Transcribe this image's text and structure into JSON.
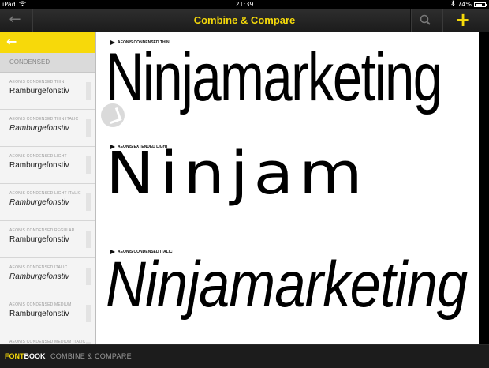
{
  "status": {
    "device": "iPad",
    "time": "21:39",
    "battery": "74%",
    "battery_level": 0.74
  },
  "nav": {
    "title": "Combine & Compare",
    "back_icon": "arrow-left-icon",
    "search_icon": "search-icon",
    "add_icon": "plus-icon"
  },
  "sidebar": {
    "section": "CONDENSED",
    "items": [
      {
        "name": "AEONIS CONDENSED THIN",
        "sample": "Ramburgefonstiv",
        "italic": false
      },
      {
        "name": "AEONIS CONDENSED THIN ITALIC",
        "sample": "Ramburgefonstiv",
        "italic": true
      },
      {
        "name": "AEONIS CONDENSED LIGHT",
        "sample": "Ramburgefonstiv",
        "italic": false
      },
      {
        "name": "AEONIS CONDENSED LIGHT ITALIC",
        "sample": "Ramburgefonstiv",
        "italic": true
      },
      {
        "name": "AEONIS CONDENSED REGULAR",
        "sample": "Ramburgefonstiv",
        "italic": false
      },
      {
        "name": "AEONIS CONDENSED ITALIC",
        "sample": "Ramburgefonstiv",
        "italic": true
      },
      {
        "name": "AEONIS CONDENSED MEDIUM",
        "sample": "Ramburgefonstiv",
        "italic": false
      },
      {
        "name": "AEONIS CONDENSED MEDIUM ITALIC",
        "sample": "",
        "italic": true
      }
    ]
  },
  "samples": [
    {
      "label": "AEONIS CONDENSED THIN",
      "text": "Ninjamarketing"
    },
    {
      "label": "AEONIS EXTENDED LIGHT",
      "text": "Ninjam"
    },
    {
      "label": "AEONIS CONDENSED ITALIC",
      "text": "Ninjamarketing"
    }
  ],
  "bottom": {
    "brand_a": "FONT",
    "brand_b": "BOOK",
    "crumb": "COMBINE & COMPARE"
  },
  "colors": {
    "accent": "#f5d90a"
  }
}
